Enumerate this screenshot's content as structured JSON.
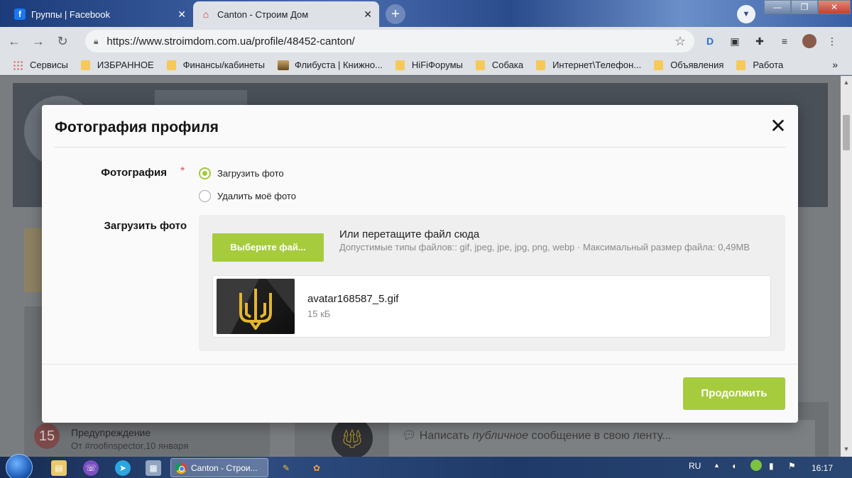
{
  "browser": {
    "tabs": [
      {
        "label": "Группы | Facebook",
        "favicon": "facebook-icon"
      },
      {
        "label": "Canton - Строим Дом",
        "favicon": "house-icon"
      }
    ],
    "url": "https://www.stroimdom.com.ua/profile/48452-canton/",
    "bookmarks": [
      {
        "label": "Сервисы",
        "icon": "apps-grid-icon"
      },
      {
        "label": "ИЗБРАННОЕ",
        "icon": "folder-icon"
      },
      {
        "label": "Финансы/кабинеты",
        "icon": "folder-icon"
      },
      {
        "label": "Флибуста | Книжно...",
        "icon": "flibusta-icon"
      },
      {
        "label": "HiFiФорумы",
        "icon": "folder-icon"
      },
      {
        "label": "Собака",
        "icon": "folder-icon"
      },
      {
        "label": "Интернет\\Телефон...",
        "icon": "folder-icon"
      },
      {
        "label": "Объявления",
        "icon": "folder-icon"
      },
      {
        "label": "Работа",
        "icon": "folder-icon"
      }
    ],
    "more": "»"
  },
  "background": {
    "warning_count": "15",
    "warning_title": "Предупреждение",
    "warning_sub": "От #roofinspector,10 января",
    "feed_prefix": "Написать ",
    "feed_italic": "публичное",
    "feed_suffix": " сообщение в свою ленту..."
  },
  "modal": {
    "title": "Фотография профиля",
    "close_label": "✕",
    "photo_label": "Фотография",
    "required_mark": "*",
    "options": [
      {
        "label": "Загрузить фото",
        "selected": true
      },
      {
        "label": "Удалить моё фото",
        "selected": false
      }
    ],
    "upload_label": "Загрузить фото",
    "choose_button": "Выберите фай...",
    "drop_title": "Или перетащите файл сюда",
    "drop_hint": "Допустимые типы файлов:: gif, jpeg, jpe, jpg, png, webp · Максимальный размер файла: 0,49MB",
    "file": {
      "name": "avatar168587_5.gif",
      "size": "15 кБ"
    },
    "continue_button": "Продолжить"
  },
  "taskbar": {
    "active_task": "Canton - Строи...",
    "language": "RU",
    "time": "16:17"
  },
  "colors": {
    "accent": "#a6cc3d",
    "required": "#d9534f"
  }
}
